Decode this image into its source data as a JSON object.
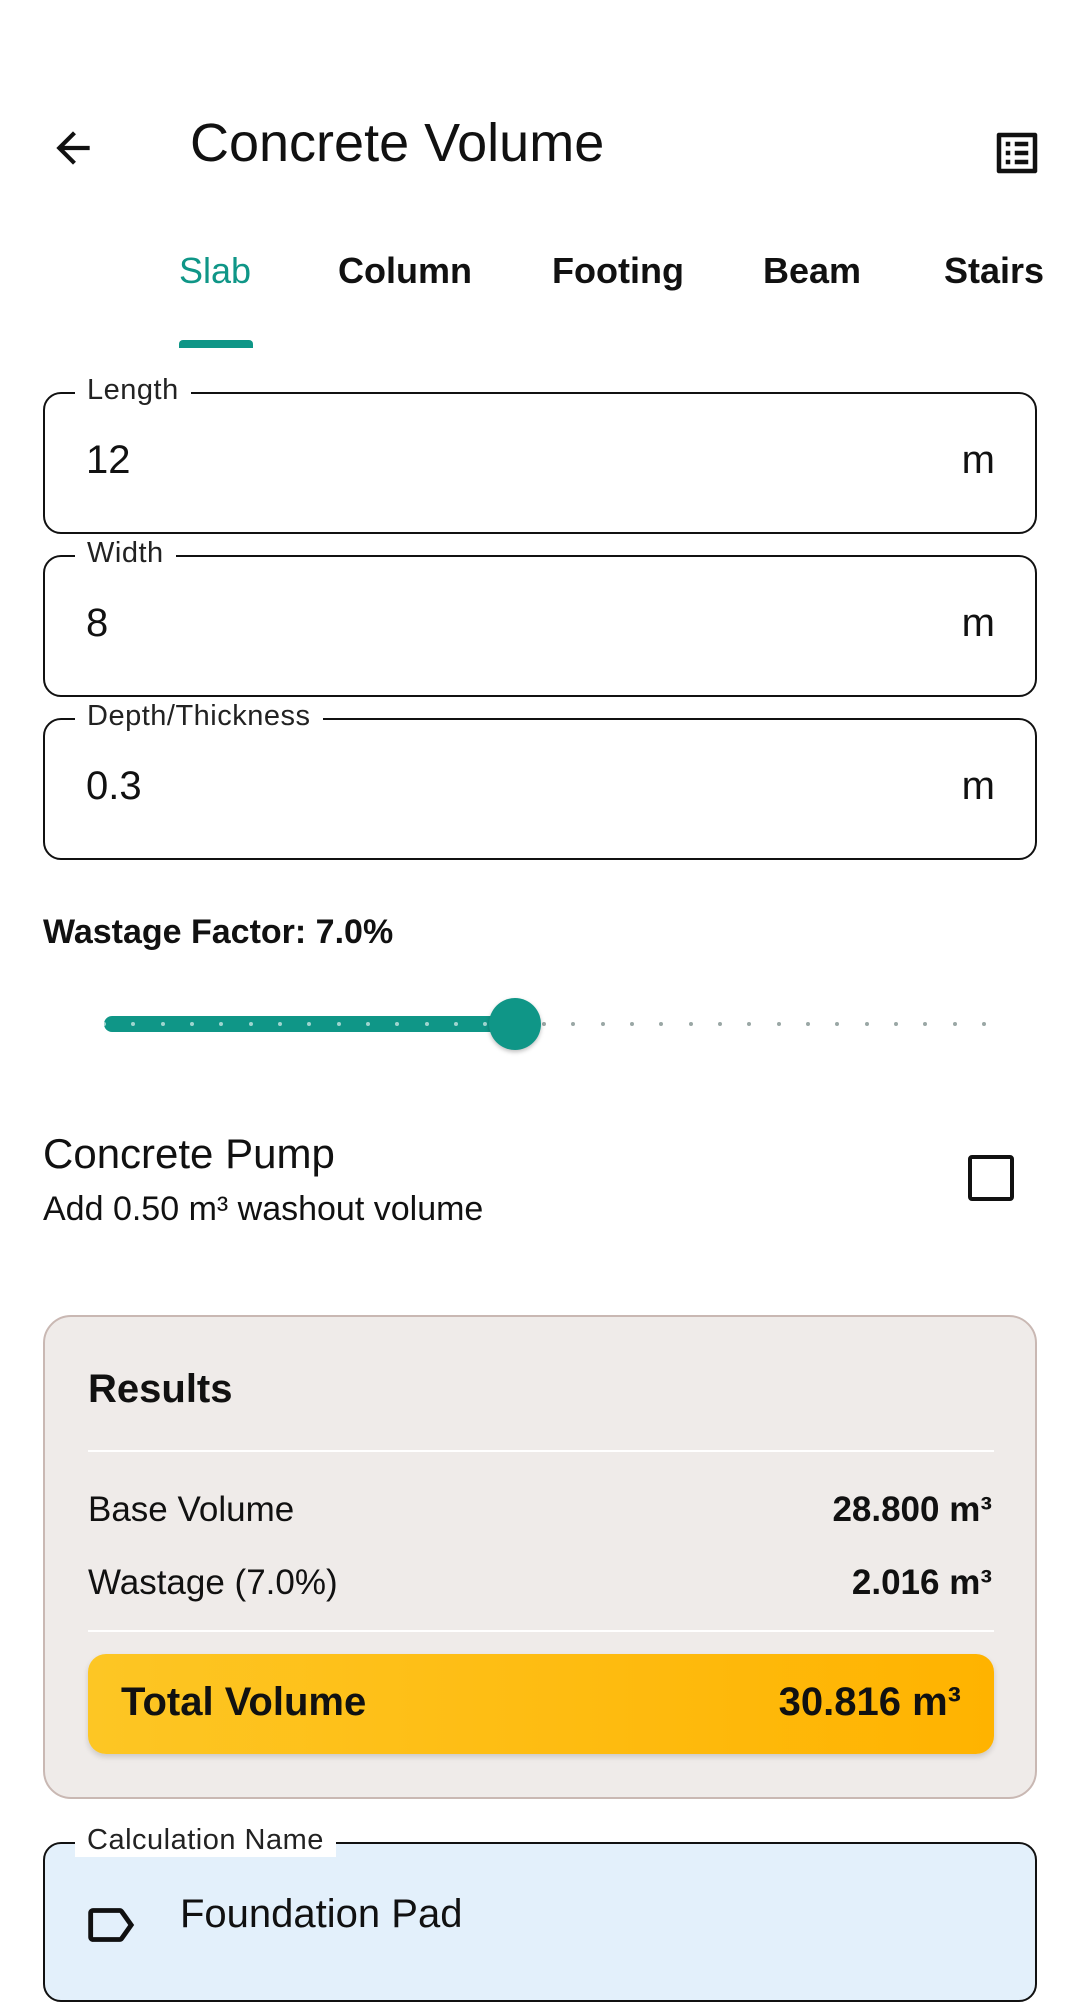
{
  "app_bar": {
    "title": "Concrete Volume",
    "back_icon": "arrow-left-icon",
    "action_icon": "list-alt-icon"
  },
  "tabs": [
    {
      "label": "Slab",
      "active": true
    },
    {
      "label": "Column",
      "active": false
    },
    {
      "label": "Footing",
      "active": false
    },
    {
      "label": "Beam",
      "active": false
    },
    {
      "label": "Stairs",
      "active": false
    }
  ],
  "fields": {
    "length": {
      "label": "Length",
      "value": "12",
      "unit": "m"
    },
    "width": {
      "label": "Width",
      "value": "8",
      "unit": "m"
    },
    "depth": {
      "label": "Depth/Thickness",
      "value": "0.3",
      "unit": "m"
    }
  },
  "wastage": {
    "label": "Wastage Factor: 7.0%",
    "value_percent": 7.0,
    "min_percent": 0,
    "max_percent": 15,
    "divisions": 30
  },
  "pump": {
    "title": "Concrete Pump",
    "subtitle": "Add 0.50 m³ washout volume",
    "checked": false
  },
  "results": {
    "title": "Results",
    "base_label": "Base Volume",
    "base_value": "28.800 m³",
    "wastage_label": "Wastage (7.0%)",
    "wastage_value": "2.016 m³",
    "total_label": "Total Volume",
    "total_value": "30.816 m³"
  },
  "calc_name": {
    "label": "Calculation Name",
    "value": "Foundation Pad",
    "icon": "label-tag-icon"
  },
  "colors": {
    "accent": "#0f9687",
    "results_bg": "#efebe9",
    "total_gradient_start": "#fdc624",
    "total_gradient_end": "#ffb300",
    "calc_field_bg": "#e3f0fb"
  }
}
